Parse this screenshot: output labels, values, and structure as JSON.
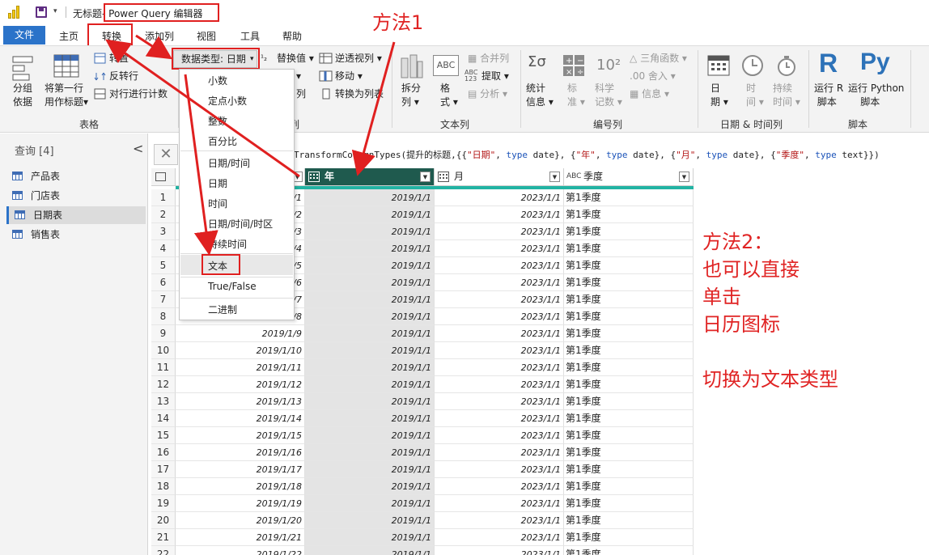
{
  "titlebar": {
    "doc_name": "无标题",
    "app_name": "- Power Query 编辑器",
    "dropdown_glyph": "▾"
  },
  "tabs": [
    "文件",
    "主页",
    "转换",
    "添加列",
    "视图",
    "工具",
    "帮助"
  ],
  "ribbon": {
    "group_by": "分组",
    "group_by2": "依据",
    "first_row": "将第一行",
    "first_row2": "用作标题",
    "transpose": "转置",
    "reverse_rows": "反转行",
    "count_rows": "对行进行计数",
    "table_group": "表格",
    "data_type": "数据类型: 日期",
    "replace_values": "替换值",
    "unpivot": "逆透视列",
    "move": "移动",
    "to_list": "转换为列表",
    "col_partial": "列",
    "split_col": "拆分",
    "split_col2": "列",
    "format": "格",
    "format2": "式",
    "merge_cols": "合并列",
    "extract": "提取",
    "parse": "分析",
    "text_col_group": "文本列",
    "stats": "统计",
    "stats2": "信息",
    "standard": "标",
    "standard2": "准",
    "scientific": "科学",
    "scientific2": "记数",
    "trig": "三角函数",
    "rounding": "舍入",
    "info": "信息",
    "number_col_group": "编号列",
    "date": "日",
    "date2": "期",
    "time": "时",
    "time2": "间",
    "duration": "持续",
    "duration2": "时间",
    "datetime_group": "日期 & 时间列",
    "run_r": "运行 R",
    "run_r2": "脚本",
    "run_py": "运行 Python",
    "run_py2": "脚本",
    "script_group": "脚本",
    "r_glyph": "R",
    "py_glyph": "Py",
    "scientific_glyph": "10²",
    "trig_glyph": "△",
    "sigma_glyph": "Σσ",
    "abc_glyph": "ABC"
  },
  "queries": {
    "header": "查询 [4]",
    "collapse_glyph": "<",
    "items": [
      "产品表",
      "门店表",
      "日期表",
      "销售表"
    ]
  },
  "formula": {
    "close_glyph": "✕",
    "p1": "TransformColumnTypes(提升的标题,{{",
    "s1": "\"日期\"",
    "p2": ", ",
    "k1": "type",
    "p3": " date}, {",
    "s2": "\"年\"",
    "p4": ", ",
    "k2": "type",
    "p5": " date}, {",
    "s3": "\"月\"",
    "p6": ", ",
    "k3": "type",
    "p7": " date}, {",
    "s4": "\"季度\"",
    "p8": ", ",
    "k4": "type",
    "p9": " text}})"
  },
  "grid": {
    "columns": [
      {
        "name": "年",
        "type_icon": "calendar"
      },
      {
        "name": "月",
        "type_icon": "calendar"
      },
      {
        "name": "季度",
        "type_icon": "ABC"
      }
    ],
    "type_abc": "ABC",
    "rows": [
      {
        "n": "1",
        "date": "/1",
        "year": "2019/1/1",
        "month": "2023/1/1",
        "quarter": "第1季度"
      },
      {
        "n": "2",
        "date": "/2",
        "year": "2019/1/1",
        "month": "2023/1/1",
        "quarter": "第1季度"
      },
      {
        "n": "3",
        "date": "/3",
        "year": "2019/1/1",
        "month": "2023/1/1",
        "quarter": "第1季度"
      },
      {
        "n": "4",
        "date": "/4",
        "year": "2019/1/1",
        "month": "2023/1/1",
        "quarter": "第1季度"
      },
      {
        "n": "5",
        "date": "/5",
        "year": "2019/1/1",
        "month": "2023/1/1",
        "quarter": "第1季度"
      },
      {
        "n": "6",
        "date": "/6",
        "year": "2019/1/1",
        "month": "2023/1/1",
        "quarter": "第1季度"
      },
      {
        "n": "7",
        "date": "/7",
        "year": "2019/1/1",
        "month": "2023/1/1",
        "quarter": "第1季度"
      },
      {
        "n": "8",
        "date": "/8",
        "year": "2019/1/1",
        "month": "2023/1/1",
        "quarter": "第1季度"
      },
      {
        "n": "9",
        "date": "2019/1/9",
        "year": "2019/1/1",
        "month": "2023/1/1",
        "quarter": "第1季度"
      },
      {
        "n": "10",
        "date": "2019/1/10",
        "year": "2019/1/1",
        "month": "2023/1/1",
        "quarter": "第1季度"
      },
      {
        "n": "11",
        "date": "2019/1/11",
        "year": "2019/1/1",
        "month": "2023/1/1",
        "quarter": "第1季度"
      },
      {
        "n": "12",
        "date": "2019/1/12",
        "year": "2019/1/1",
        "month": "2023/1/1",
        "quarter": "第1季度"
      },
      {
        "n": "13",
        "date": "2019/1/13",
        "year": "2019/1/1",
        "month": "2023/1/1",
        "quarter": "第1季度"
      },
      {
        "n": "14",
        "date": "2019/1/14",
        "year": "2019/1/1",
        "month": "2023/1/1",
        "quarter": "第1季度"
      },
      {
        "n": "15",
        "date": "2019/1/15",
        "year": "2019/1/1",
        "month": "2023/1/1",
        "quarter": "第1季度"
      },
      {
        "n": "16",
        "date": "2019/1/16",
        "year": "2019/1/1",
        "month": "2023/1/1",
        "quarter": "第1季度"
      },
      {
        "n": "17",
        "date": "2019/1/17",
        "year": "2019/1/1",
        "month": "2023/1/1",
        "quarter": "第1季度"
      },
      {
        "n": "18",
        "date": "2019/1/18",
        "year": "2019/1/1",
        "month": "2023/1/1",
        "quarter": "第1季度"
      },
      {
        "n": "19",
        "date": "2019/1/19",
        "year": "2019/1/1",
        "month": "2023/1/1",
        "quarter": "第1季度"
      },
      {
        "n": "20",
        "date": "2019/1/20",
        "year": "2019/1/1",
        "month": "2023/1/1",
        "quarter": "第1季度"
      },
      {
        "n": "21",
        "date": "2019/1/21",
        "year": "2019/1/1",
        "month": "2023/1/1",
        "quarter": "第1季度"
      },
      {
        "n": "22",
        "date": "2019/1/22",
        "year": "2019/1/1",
        "month": "2023/1/1",
        "quarter": "第1季度"
      }
    ]
  },
  "menu": {
    "items": [
      "小数",
      "定点小数",
      "整数",
      "百分比",
      "日期/时间",
      "日期",
      "时间",
      "日期/时间/时区",
      "持续时间",
      "文本",
      "True/False",
      "二进制"
    ]
  },
  "annotations": {
    "method1": "方法1",
    "method2_lines": [
      "方法2：",
      "也可以直接",
      "单击",
      "日历图标",
      "",
      "切换为文本类型"
    ]
  },
  "colors": {
    "accent_blue": "#2b73c9",
    "selected_header": "#1f5a4e",
    "teal_bar": "#22b3a3",
    "annotation_red": "#e02020"
  }
}
